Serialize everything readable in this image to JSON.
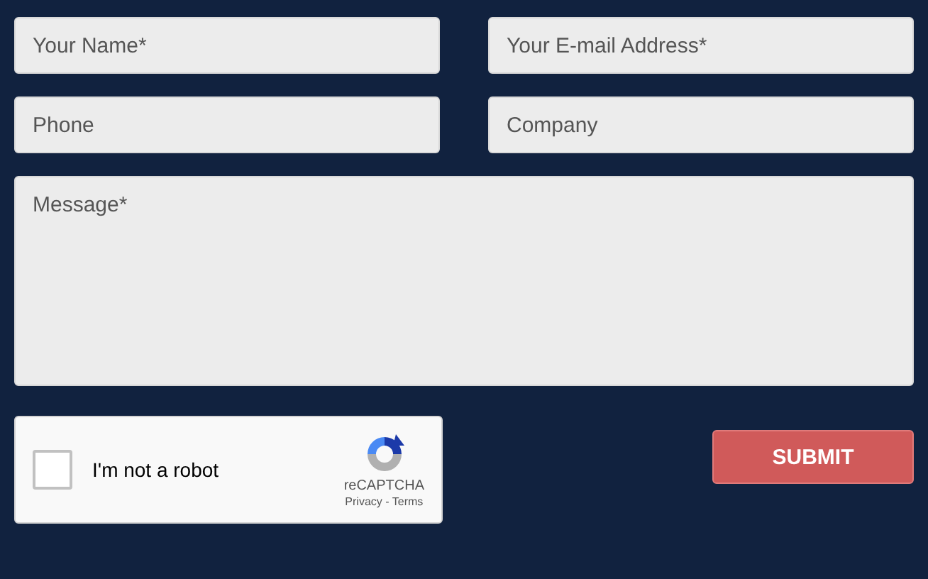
{
  "fields": [
    {
      "placeholder": "Your Name*"
    },
    {
      "placeholder": "Your E-mail Address*"
    },
    {
      "placeholder": "Phone"
    },
    {
      "placeholder": "Company"
    }
  ],
  "message": {
    "placeholder": "Message*"
  },
  "captcha": {
    "label": "I'm not a robot",
    "checked": false,
    "brand": "reCAPTCHA",
    "links": "Privacy - Terms"
  },
  "submit": "SUBMIT"
}
